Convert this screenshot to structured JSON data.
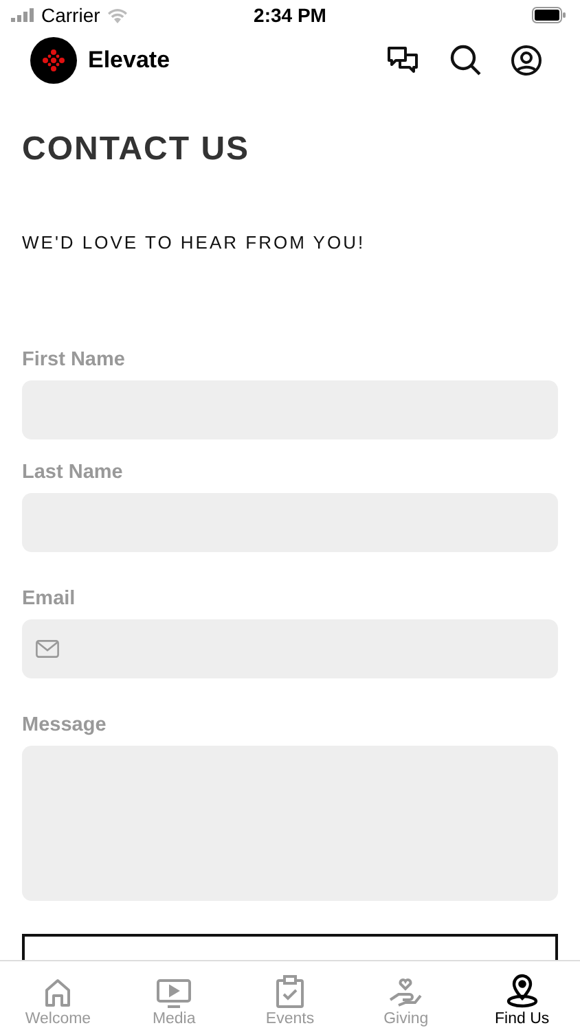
{
  "status_bar": {
    "carrier": "Carrier",
    "time": "2:34 PM"
  },
  "header": {
    "title": "Elevate"
  },
  "page": {
    "title": "CONTACT US",
    "subtitle": "WE'D LOVE TO HEAR FROM YOU!"
  },
  "fields": [
    {
      "label": "First Name",
      "kind": "text"
    },
    {
      "label": "Last Name",
      "kind": "text"
    },
    {
      "label": "Email",
      "kind": "email"
    },
    {
      "label": "Message",
      "kind": "textarea"
    }
  ],
  "tabs": [
    {
      "label": "Welcome",
      "kind": "home",
      "selected": false
    },
    {
      "label": "Media",
      "kind": "media",
      "selected": false
    },
    {
      "label": "Events",
      "kind": "events",
      "selected": false
    },
    {
      "label": "Giving",
      "kind": "giving",
      "selected": false
    },
    {
      "label": "Find Us",
      "kind": "pin",
      "selected": true
    }
  ]
}
